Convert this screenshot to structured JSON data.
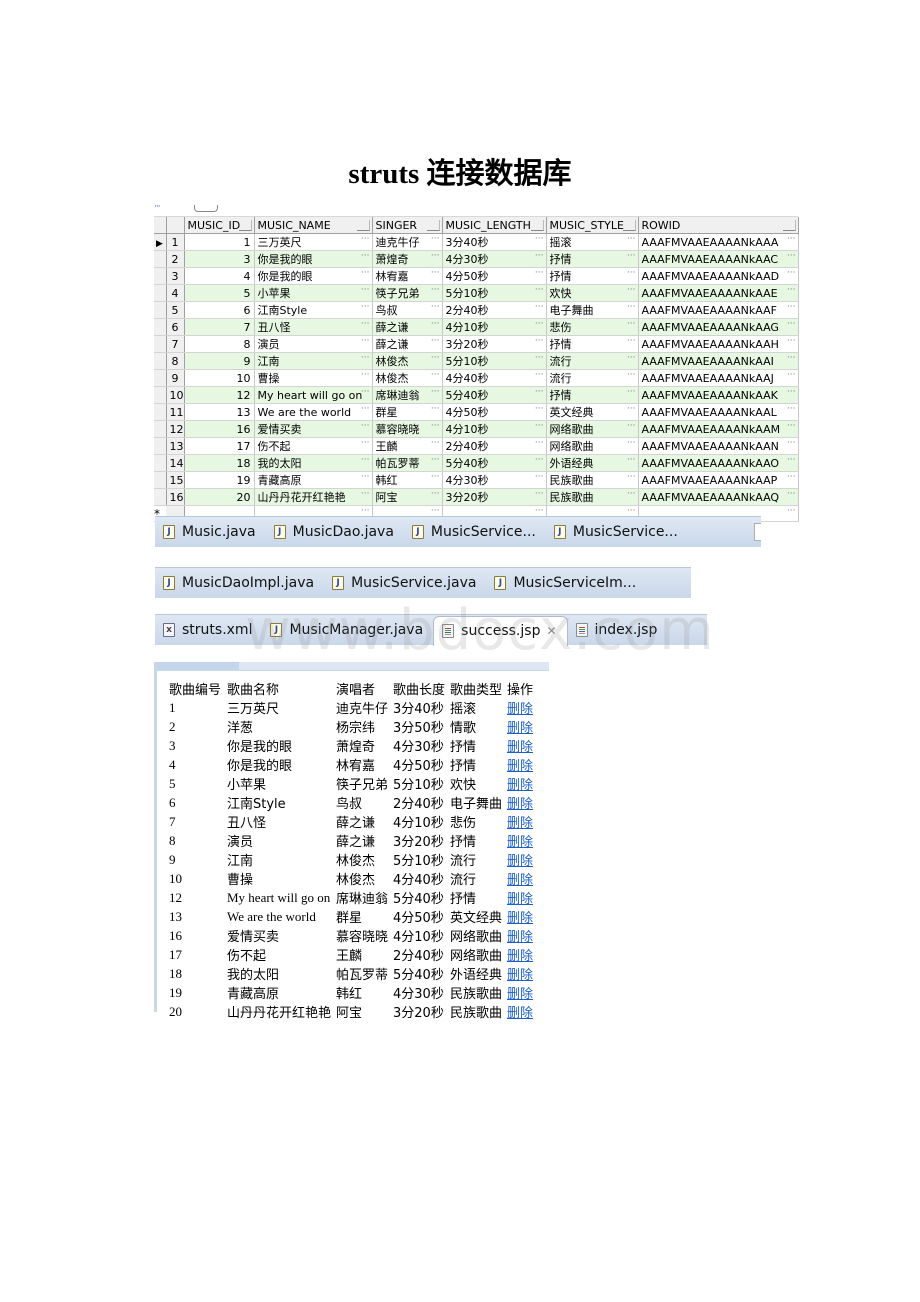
{
  "title": "struts 连接数据库",
  "db_grid": {
    "columns": [
      "MUSIC_ID",
      "MUSIC_NAME",
      "SINGER",
      "MUSIC_LENGTH",
      "MUSIC_STYLE",
      "ROWID"
    ],
    "current_row_indicator": "▶",
    "new_row_indicator": "*",
    "ellipsis": "···",
    "rows": [
      {
        "n": "1",
        "id": "1",
        "name": "三万英尺",
        "singer": "迪克牛仔",
        "length": "3分40秒",
        "style": "摇滚",
        "rowid": "AAAFMVAAEAAAANkAAA"
      },
      {
        "n": "2",
        "id": "3",
        "name": "你是我的眼",
        "singer": "萧煌奇",
        "length": "4分30秒",
        "style": "抒情",
        "rowid": "AAAFMVAAEAAAANkAAC"
      },
      {
        "n": "3",
        "id": "4",
        "name": "你是我的眼",
        "singer": "林宥嘉",
        "length": "4分50秒",
        "style": "抒情",
        "rowid": "AAAFMVAAEAAAANkAAD"
      },
      {
        "n": "4",
        "id": "5",
        "name": "小苹果",
        "singer": "筷子兄弟",
        "length": "5分10秒",
        "style": "欢快",
        "rowid": "AAAFMVAAEAAAANkAAE"
      },
      {
        "n": "5",
        "id": "6",
        "name": "江南Style",
        "singer": "鸟叔",
        "length": "2分40秒",
        "style": "电子舞曲",
        "rowid": "AAAFMVAAEAAAANkAAF"
      },
      {
        "n": "6",
        "id": "7",
        "name": "丑八怪",
        "singer": "薛之谦",
        "length": "4分10秒",
        "style": "悲伤",
        "rowid": "AAAFMVAAEAAAANkAAG"
      },
      {
        "n": "7",
        "id": "8",
        "name": "演员",
        "singer": "薛之谦",
        "length": "3分20秒",
        "style": "抒情",
        "rowid": "AAAFMVAAEAAAANkAAH"
      },
      {
        "n": "8",
        "id": "9",
        "name": "江南",
        "singer": "林俊杰",
        "length": "5分10秒",
        "style": "流行",
        "rowid": "AAAFMVAAEAAAANkAAI"
      },
      {
        "n": "9",
        "id": "10",
        "name": "曹操",
        "singer": "林俊杰",
        "length": "4分40秒",
        "style": "流行",
        "rowid": "AAAFMVAAEAAAANkAAJ"
      },
      {
        "n": "10",
        "id": "12",
        "name": "My heart will go on",
        "singer": "席琳迪翁",
        "length": "5分40秒",
        "style": "抒情",
        "rowid": "AAAFMVAAEAAAANkAAK"
      },
      {
        "n": "11",
        "id": "13",
        "name": "We are the world",
        "singer": "群星",
        "length": "4分50秒",
        "style": "英文经典",
        "rowid": "AAAFMVAAEAAAANkAAL"
      },
      {
        "n": "12",
        "id": "16",
        "name": "爱情买卖",
        "singer": "慕容晓晓",
        "length": "4分10秒",
        "style": "网络歌曲",
        "rowid": "AAAFMVAAEAAAANkAAM"
      },
      {
        "n": "13",
        "id": "17",
        "name": "伤不起",
        "singer": "王麟",
        "length": "2分40秒",
        "style": "网络歌曲",
        "rowid": "AAAFMVAAEAAAANkAAN"
      },
      {
        "n": "14",
        "id": "18",
        "name": "我的太阳",
        "singer": "帕瓦罗蒂",
        "length": "5分40秒",
        "style": "外语经典",
        "rowid": "AAAFMVAAEAAAANkAAO"
      },
      {
        "n": "15",
        "id": "19",
        "name": "青藏高原",
        "singer": "韩红",
        "length": "4分30秒",
        "style": "民族歌曲",
        "rowid": "AAAFMVAAEAAAANkAAP"
      },
      {
        "n": "16",
        "id": "20",
        "name": "山丹丹花开红艳艳",
        "singer": "阿宝",
        "length": "3分20秒",
        "style": "民族歌曲",
        "rowid": "AAAFMVAAEAAAANkAAQ"
      }
    ]
  },
  "tab_bars": [
    {
      "tabs": [
        {
          "label": "Music.java",
          "icon": "java-file-icon"
        },
        {
          "label": "MusicDao.java",
          "icon": "java-file-icon"
        },
        {
          "label": "MusicService...",
          "icon": "java-file-icon"
        },
        {
          "label": "MusicService...",
          "icon": "java-file-icon"
        }
      ]
    },
    {
      "tabs": [
        {
          "label": "MusicDaoImpl.java",
          "icon": "java-file-icon"
        },
        {
          "label": "MusicService.java",
          "icon": "java-file-icon"
        },
        {
          "label": "MusicServiceIm...",
          "icon": "java-file-icon"
        }
      ]
    },
    {
      "tabs": [
        {
          "label": "struts.xml",
          "icon": "xml-file-icon"
        },
        {
          "label": "MusicManager.java",
          "icon": "java-file-icon"
        },
        {
          "label": "success.jsp",
          "icon": "jsp-file-icon",
          "active": true,
          "close": "✕"
        },
        {
          "label": "index.jsp",
          "icon": "jsp-file-icon"
        }
      ]
    }
  ],
  "output_table": {
    "headers": [
      "歌曲编号",
      "歌曲名称",
      "演唱者",
      "歌曲长度",
      "歌曲类型",
      "操作"
    ],
    "action_label": "删除",
    "link_color": "#1a5fd0",
    "rows": [
      {
        "id": "1",
        "name": "三万英尺",
        "singer": "迪克牛仔",
        "length": "3分40秒",
        "style": "摇滚"
      },
      {
        "id": "2",
        "name": "洋葱",
        "singer": "杨宗纬",
        "length": "3分50秒",
        "style": "情歌"
      },
      {
        "id": "3",
        "name": "你是我的眼",
        "singer": "萧煌奇",
        "length": "4分30秒",
        "style": "抒情"
      },
      {
        "id": "4",
        "name": "你是我的眼",
        "singer": "林宥嘉",
        "length": "4分50秒",
        "style": "抒情"
      },
      {
        "id": "5",
        "name": "小苹果",
        "singer": "筷子兄弟",
        "length": "5分10秒",
        "style": "欢快"
      },
      {
        "id": "6",
        "name": "江南Style",
        "singer": "鸟叔",
        "length": "2分40秒",
        "style": "电子舞曲"
      },
      {
        "id": "7",
        "name": "丑八怪",
        "singer": "薛之谦",
        "length": "4分10秒",
        "style": "悲伤"
      },
      {
        "id": "8",
        "name": "演员",
        "singer": "薛之谦",
        "length": "3分20秒",
        "style": "抒情"
      },
      {
        "id": "9",
        "name": "江南",
        "singer": "林俊杰",
        "length": "5分10秒",
        "style": "流行"
      },
      {
        "id": "10",
        "name": "曹操",
        "singer": "林俊杰",
        "length": "4分40秒",
        "style": "流行"
      },
      {
        "id": "12",
        "name": "My heart will go on",
        "singer": "席琳迪翁",
        "length": "5分40秒",
        "style": "抒情"
      },
      {
        "id": "13",
        "name": "We are the world",
        "singer": "群星",
        "length": "4分50秒",
        "style": "英文经典"
      },
      {
        "id": "16",
        "name": "爱情买卖",
        "singer": "慕容晓晓",
        "length": "4分10秒",
        "style": "网络歌曲"
      },
      {
        "id": "17",
        "name": "伤不起",
        "singer": "王麟",
        "length": "2分40秒",
        "style": "网络歌曲"
      },
      {
        "id": "18",
        "name": "我的太阳",
        "singer": "帕瓦罗蒂",
        "length": "5分40秒",
        "style": "外语经典"
      },
      {
        "id": "19",
        "name": "青藏高原",
        "singer": "韩红",
        "length": "4分30秒",
        "style": "民族歌曲"
      },
      {
        "id": "20",
        "name": "山丹丹花开红艳艳",
        "singer": "阿宝",
        "length": "3分20秒",
        "style": "民族歌曲"
      }
    ]
  },
  "watermark": "www.bdocx.com"
}
